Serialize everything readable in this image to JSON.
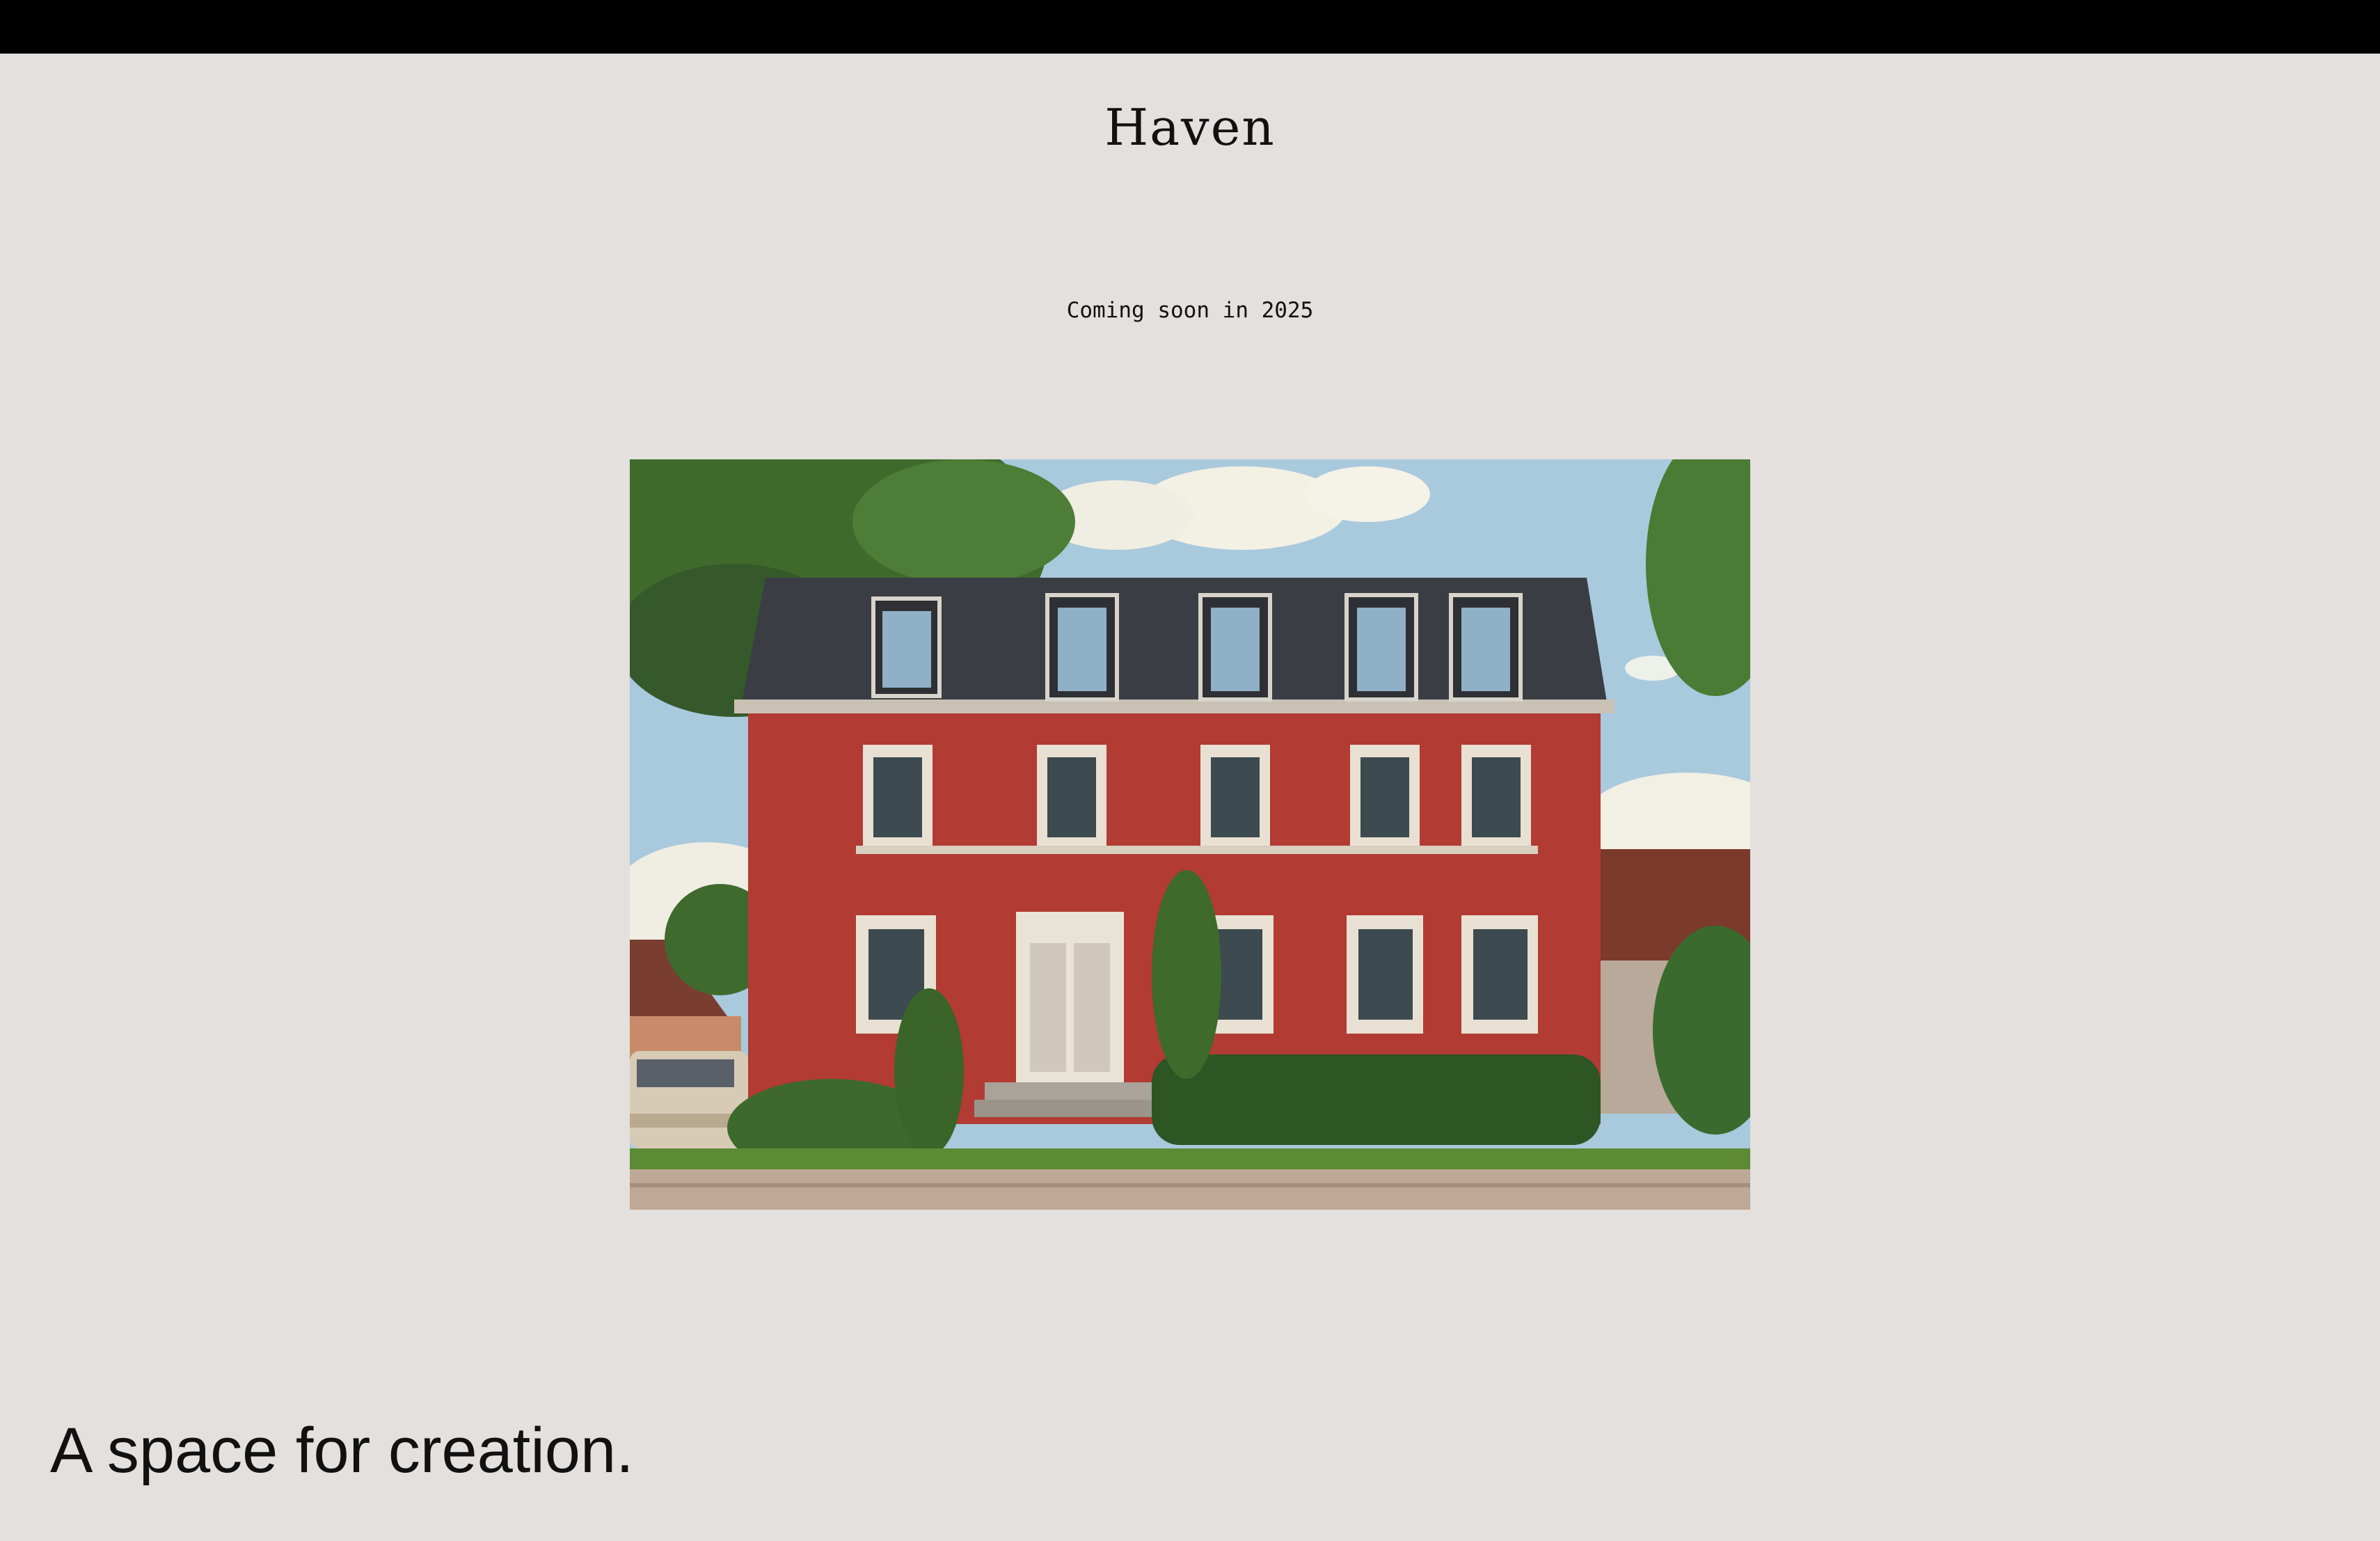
{
  "brand": {
    "logo_text": "Haven"
  },
  "hero": {
    "announcement": "Coming soon in 2025",
    "image_alt": "red-three-story-house-photo"
  },
  "footer": {
    "tagline": "A space for creation."
  },
  "colors": {
    "background": "#e3e0dd",
    "top_bar": "#000000",
    "text": "#111111",
    "house_wall": "#b23b33",
    "roof": "#3b3d44"
  }
}
